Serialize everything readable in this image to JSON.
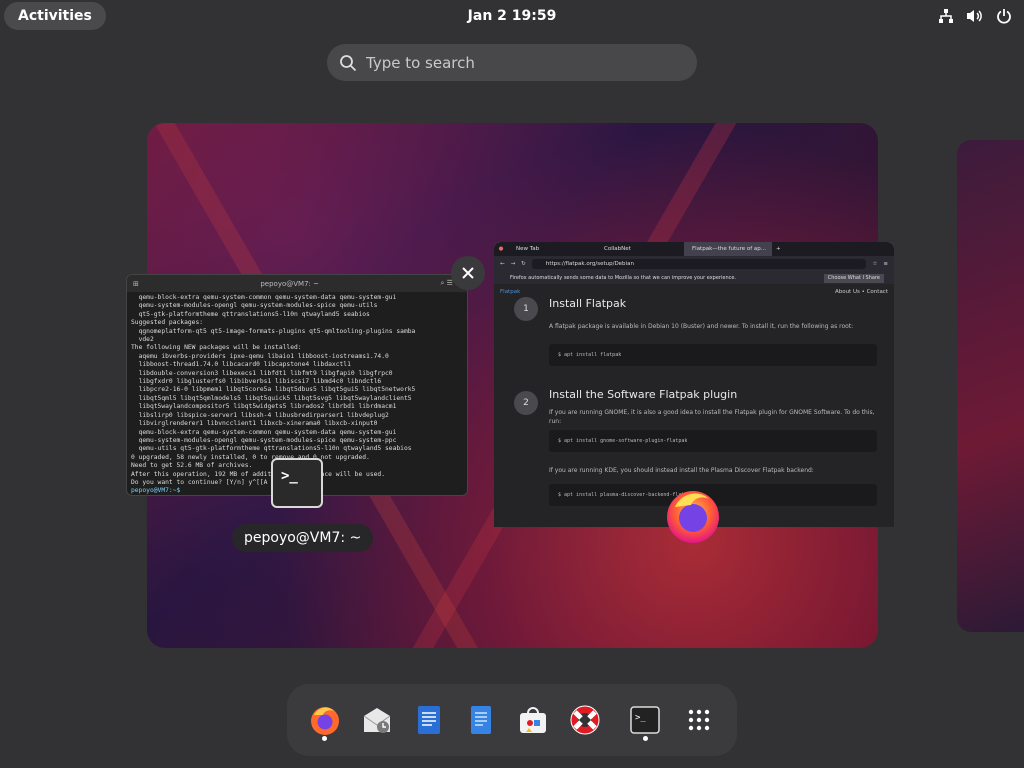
{
  "topbar": {
    "activities_label": "Activities",
    "clock": "Jan 2  19:59",
    "tray_icons": [
      "network-icon",
      "volume-icon",
      "power-icon"
    ]
  },
  "search": {
    "placeholder": "Type to search"
  },
  "windows": {
    "terminal": {
      "title": "pepoyo@VM7: ~",
      "label": "pepoyo@VM7: ~",
      "lines": [
        "  qemu-block-extra qemu-system-common qemu-system-data qemu-system-gui",
        "  qemu-system-modules-opengl qemu-system-modules-spice qemu-utils",
        "  qt5-gtk-platformtheme qttranslations5-l10n qtwayland5 seabios",
        "Suggested packages:",
        "  qgnomeplatform-qt5 qt5-image-formats-plugins qt5-qmltooling-plugins samba",
        "  vde2",
        "The following NEW packages will be installed:",
        "  aqemu ibverbs-providers ipxe-qemu libaio1 libboost-iostreams1.74.0",
        "  libboost-thread1.74.0 libcacard0 libcapstone4 libdaxctl1",
        "  libdouble-conversion3 libexecs1 libfdt1 libfmt9 libgfapi0 libgfrpc0",
        "  libgfxdr0 libglusterfs0 libibverbs1 libiscsi7 libmd4c0 libndctl6",
        "  libpcre2-16-0 libpmem1 libqt5core5a libqt5dbus5 libqt5gui5 libqt5network5",
        "  libqt5qml5 libqt5qmlmodels5 libqt5quick5 libqt5svg5 libqt5waylandclient5",
        "  libqt5waylandcompositor5 libqt5widgets5 librados2 librbd1 librdmacm1",
        "  libslirp0 libspice-server1 libssh-4 libusbredirparser1 libvdeplug2",
        "  libvirglrenderer1 libvncclient1 libxcb-xinerama0 libxcb-xinput0",
        "  qemu-block-extra qemu-system-common qemu-system-data qemu-system-gui",
        "  qemu-system-modules-opengl qemu-system-modules-spice qemu-system-ppc",
        "  qemu-utils qt5-gtk-platformtheme qttranslations5-l10n qtwayland5 seabios",
        "0 upgraded, 58 newly installed, 0 to remove and 0 not upgraded.",
        "Need to get 52.6 MB of archives.",
        "After this operation, 192 MB of additional disk space will be used.",
        "Do you want to continue? [Y/n] y^[[A"
      ],
      "prompt": "pepoyo@VM7:~$ "
    },
    "firefox": {
      "tabs": [
        "New Tab",
        "CollabNet",
        "Flatpak—the future of ap..."
      ],
      "url": "https://flatpak.org/setup/Debian",
      "notice": "Firefox automatically sends some data to Mozilla so that we can improve your experience.",
      "notice_button": "Choose What I Share",
      "site_brand": "Flatpak",
      "site_links": "About Us  •  Contact",
      "steps": [
        {
          "num": "1",
          "heading": "Install Flatpak",
          "text": "A flatpak package is available in Debian 10 (Buster) and newer. To install it, run the following as root:",
          "code": "$ apt install flatpak"
        },
        {
          "num": "2",
          "heading": "Install the Software Flatpak plugin",
          "text": "If you are running GNOME, it is also a good idea to install the Flatpak plugin for GNOME Software. To do this, run:",
          "code": "$ apt install gnome-software-plugin-flatpak",
          "text2": "If you are running KDE, you should instead install the Plasma Discover Flatpak backend:",
          "code2": "$ apt install plasma-discover-backend-flatpak"
        }
      ]
    }
  },
  "dock": {
    "items": [
      "firefox-icon",
      "evolution-icon",
      "writer-icon",
      "text-editor-icon",
      "software-icon",
      "help-icon",
      "terminal-icon",
      "app-grid-icon"
    ]
  }
}
